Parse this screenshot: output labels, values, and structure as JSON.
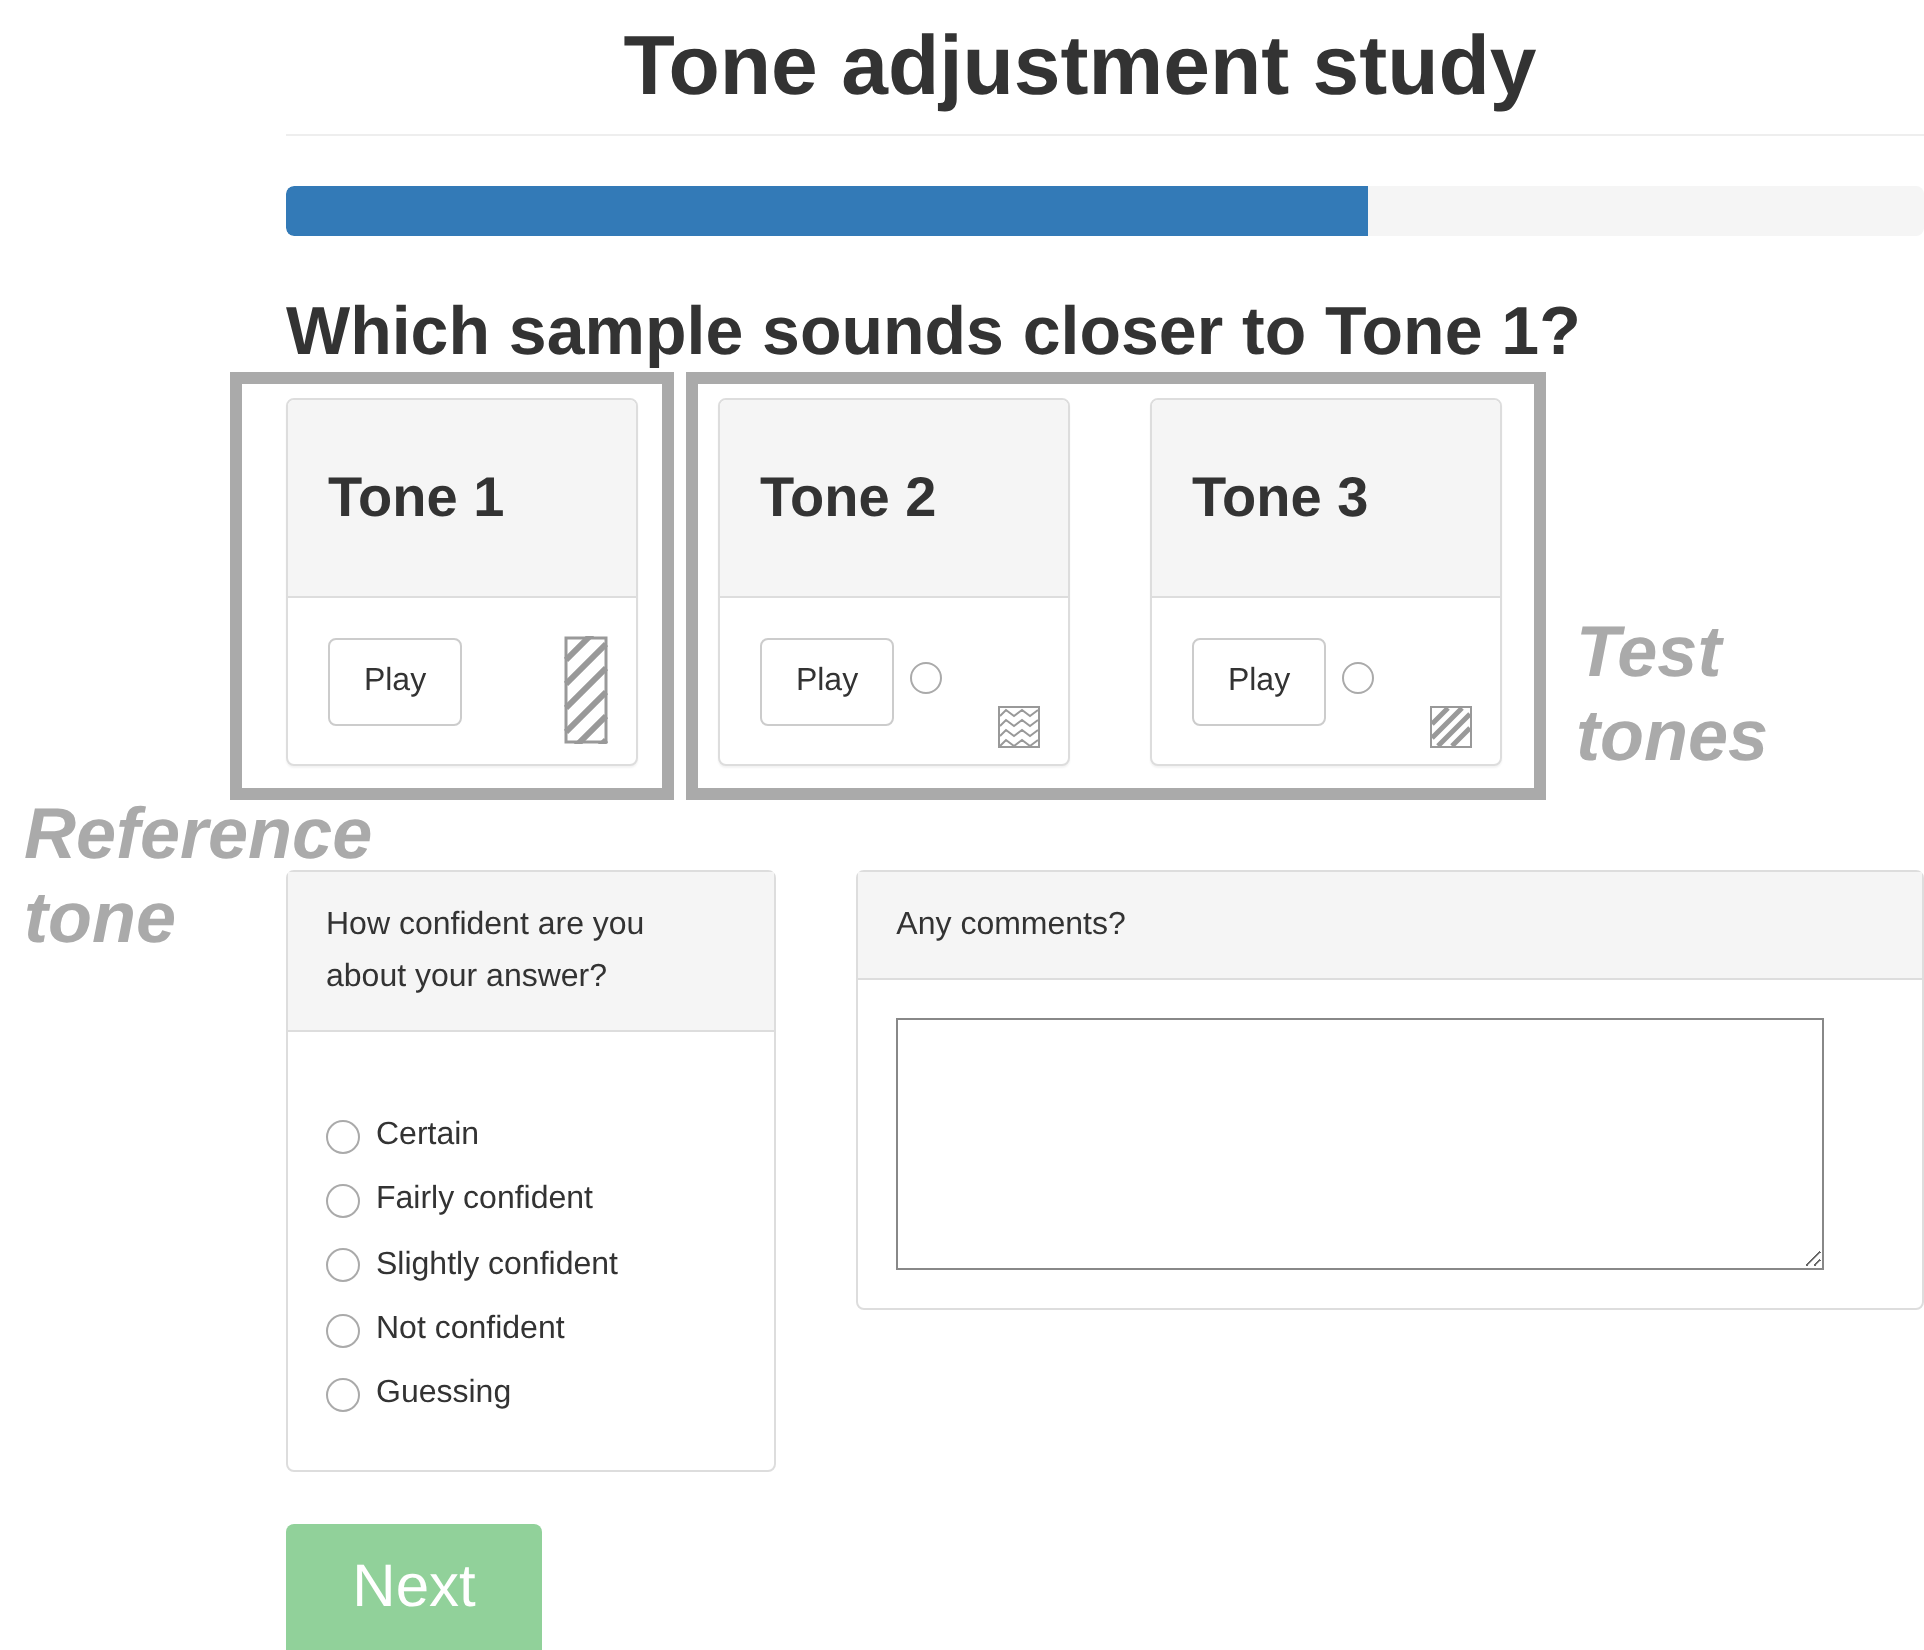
{
  "title": "Tone adjustment study",
  "progress": {
    "level": 0.66
  },
  "question": "Which sample sounds closer to Tone 1?",
  "tones": [
    {
      "kind": "reference",
      "title": "Tone 1",
      "button": "Play"
    },
    {
      "kind": "test",
      "title": "Tone 2",
      "button": "Play",
      "selected": false
    },
    {
      "kind": "test",
      "title": "Tone 3",
      "button": "Play",
      "selected": false
    }
  ],
  "confidence": {
    "heading": "How confident are you about your answer?",
    "options": [
      {
        "label": "Certain",
        "selected": false
      },
      {
        "label": "Fairly confident",
        "selected": false
      },
      {
        "label": "Slightly confident",
        "selected": false
      },
      {
        "label": "Not confident",
        "selected": false
      },
      {
        "label": "Guessing",
        "selected": false
      }
    ]
  },
  "comments": {
    "heading": "Any comments?"
  },
  "next_button": {
    "label": "Next",
    "disabled": true
  },
  "annotations": [
    {
      "label_lines": [
        "Reference",
        "tone"
      ]
    },
    {
      "label_lines": [
        "Test",
        "tones"
      ]
    }
  ]
}
